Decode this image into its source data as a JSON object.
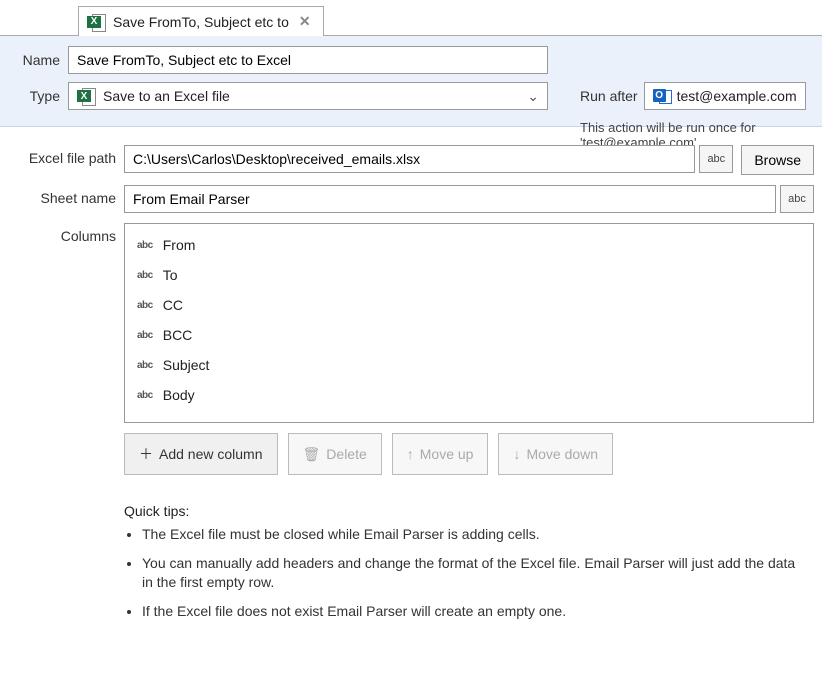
{
  "tab": {
    "label": "Save FromTo, Subject etc to"
  },
  "header": {
    "name_label": "Name",
    "name_value": "Save FromTo, Subject etc to Excel",
    "type_label": "Type",
    "type_value": "Save to an Excel file",
    "runafter_label": "Run after",
    "runafter_value": "test@example.com",
    "runafter_desc": "This action will be run once for 'test@example.com'"
  },
  "form": {
    "filepath_label": "Excel file path",
    "filepath_value": "C:\\Users\\Carlos\\Desktop\\received_emails.xlsx",
    "abc_label": "abc",
    "browse_label": "Browse",
    "sheet_label": "Sheet name",
    "sheet_value": "From Email Parser",
    "columns_label": "Columns",
    "columns": [
      "From",
      "To",
      "CC",
      "BCC",
      "Subject",
      "Body"
    ],
    "buttons": {
      "add": "Add new column",
      "delete": "Delete",
      "moveup": "Move up",
      "movedown": "Move down"
    }
  },
  "tips": {
    "title": "Quick tips:",
    "items": [
      "The Excel file must be closed while Email Parser is adding cells.",
      "You can manually add headers and change the format of the Excel file. Email Parser will just add the data in the first empty row.",
      "If the Excel file does not exist Email Parser will create an empty one."
    ]
  }
}
